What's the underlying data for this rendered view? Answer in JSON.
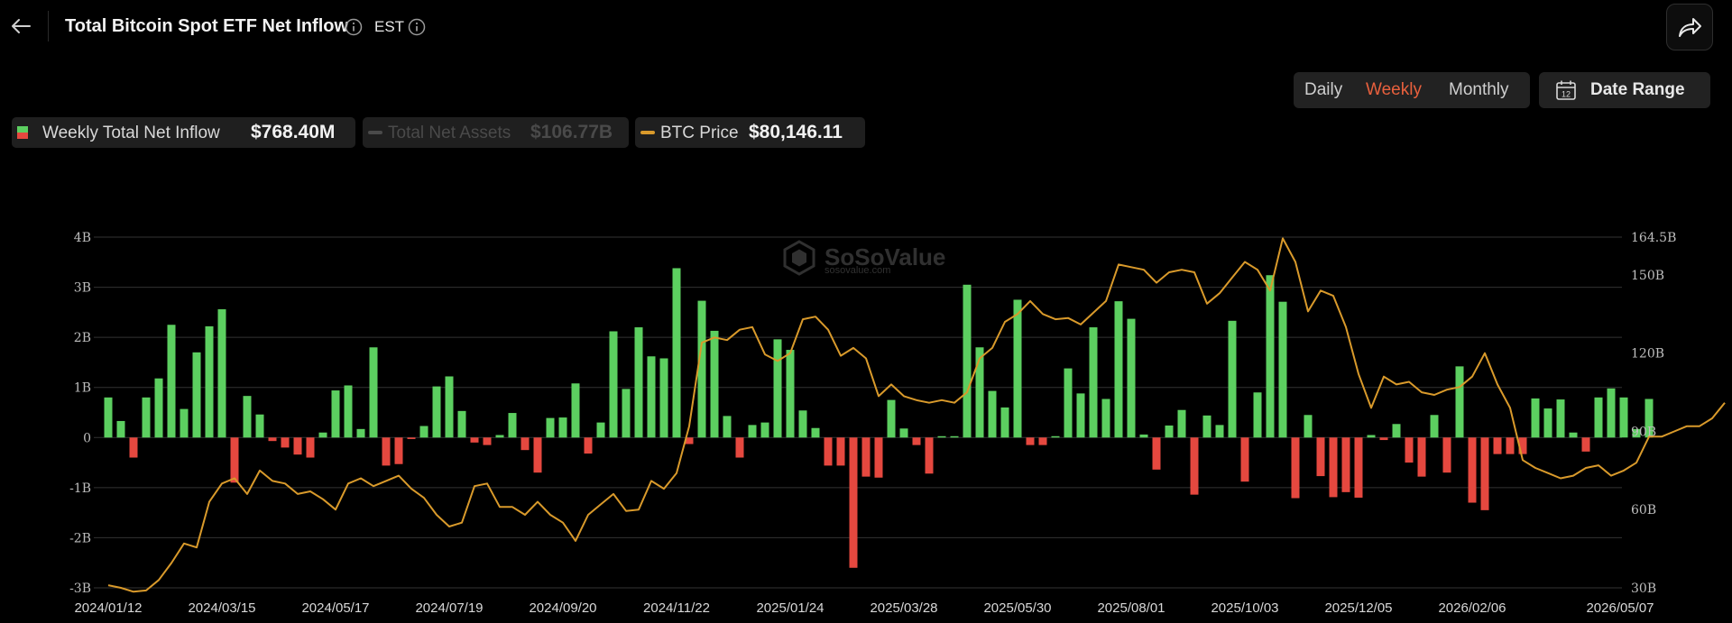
{
  "header": {
    "title": "Total Bitcoin Spot ETF Net Inflow",
    "timezone": "EST"
  },
  "controls": {
    "tabs": [
      {
        "label": "Daily",
        "active": false
      },
      {
        "label": "Weekly",
        "active": true
      },
      {
        "label": "Monthly",
        "active": false
      }
    ],
    "date_range_label": "Date Range",
    "date_range_icon_text": "12"
  },
  "legend": [
    {
      "name": "Weekly Total Net Inflow",
      "value": "$768.40M",
      "enabled": true
    },
    {
      "name": "Total Net Assets",
      "value": "$106.77B",
      "enabled": false
    },
    {
      "name": "BTC Price",
      "value": "$80,146.11",
      "enabled": true
    }
  ],
  "watermark": {
    "text": "SoSoValue",
    "sub": "sosovalue.com"
  },
  "colors": {
    "positive": "#5ccf60",
    "negative": "#e5483f",
    "price_line": "#d99a2b",
    "accent": "#e8603d"
  },
  "chart_data": {
    "type": "bar+line",
    "left_axis": {
      "ticks": [
        "4B",
        "3B",
        "2B",
        "1B",
        "0",
        "-1B",
        "-2B",
        "-3B"
      ],
      "range": [
        -3,
        4
      ],
      "unit": "B USD"
    },
    "right_axis": {
      "ticks": [
        "164.5B",
        "150B",
        "120B",
        "90B",
        "60B",
        "30B"
      ],
      "range": [
        30,
        164.5
      ]
    },
    "x_tick_labels": [
      "2024/01/12",
      "2024/03/15",
      "2024/05/17",
      "2024/07/19",
      "2024/09/20",
      "2024/11/22",
      "2025/01/24",
      "2025/03/28",
      "2025/05/30",
      "2025/08/01",
      "2025/10/03",
      "2025/12/05",
      "2026/02/06",
      "2026/05/07"
    ],
    "first_week": "2024/01/12",
    "interval": "weekly",
    "series": [
      {
        "name": "Weekly Total Net Inflow",
        "type": "bar",
        "values": [
          0.8,
          0.33,
          -0.4,
          0.8,
          1.18,
          2.25,
          0.57,
          1.7,
          2.22,
          2.56,
          -0.9,
          0.83,
          0.46,
          -0.07,
          -0.2,
          -0.34,
          -0.4,
          0.1,
          0.94,
          1.04,
          0.17,
          1.8,
          -0.56,
          -0.53,
          -0.03,
          0.23,
          1.02,
          1.22,
          0.53,
          -0.1,
          -0.15,
          0.05,
          0.49,
          -0.25,
          -0.7,
          0.39,
          0.4,
          1.08,
          -0.32,
          0.3,
          2.12,
          0.97,
          2.2,
          1.62,
          1.58,
          3.38,
          -0.13,
          2.73,
          2.13,
          0.43,
          -0.4,
          0.25,
          0.3,
          1.96,
          1.75,
          0.54,
          0.19,
          -0.56,
          -0.56,
          -2.6,
          -0.78,
          -0.8,
          0.75,
          0.18,
          -0.15,
          -0.72,
          0.02,
          0.02,
          3.05,
          1.8,
          0.93,
          0.6,
          2.75,
          -0.15,
          -0.15,
          0.02,
          1.38,
          0.88,
          2.2,
          0.77,
          2.72,
          2.37,
          0.06,
          -0.64,
          0.24,
          0.55,
          -1.14,
          0.44,
          0.25,
          2.33,
          -0.88,
          0.9,
          3.24,
          2.71,
          -1.21,
          0.45,
          -0.77,
          -1.19,
          -1.09,
          -1.2,
          0.05,
          -0.05,
          0.27,
          -0.5,
          -0.78,
          0.45,
          -0.7,
          1.42,
          -1.3,
          -1.45,
          -0.33,
          -0.33,
          -0.33,
          0.78,
          0.58,
          0.76,
          0.1,
          -0.28,
          0.8,
          0.98,
          0.8,
          0.17,
          0.77
        ]
      },
      {
        "name": "BTC Price",
        "type": "line",
        "values": [
          31,
          30,
          28.5,
          29,
          33,
          39.5,
          47,
          45.5,
          63,
          70,
          72,
          66,
          75,
          71,
          70,
          66,
          67,
          64,
          60,
          70,
          72,
          69,
          71,
          73,
          68,
          64.5,
          58,
          53.5,
          55,
          69,
          70,
          61,
          61,
          58,
          63,
          58,
          55,
          48,
          58,
          62,
          66,
          59.5,
          60,
          71,
          68,
          74,
          92,
          124,
          126,
          125,
          129,
          130,
          119.5,
          117,
          120,
          133,
          134,
          129,
          119,
          122,
          118,
          103.5,
          108,
          103.5,
          102,
          101,
          102,
          101,
          105,
          118,
          122,
          132,
          135,
          140,
          135,
          133,
          133.5,
          131,
          135.5,
          140,
          154,
          153,
          152,
          147,
          151,
          152,
          151,
          139,
          143,
          149,
          155,
          152,
          144,
          164,
          155,
          136,
          144,
          142,
          130,
          112,
          99,
          111,
          108,
          109,
          105,
          104,
          106,
          107,
          111,
          120,
          108,
          99,
          79,
          76,
          74,
          72,
          73,
          76,
          77,
          73,
          75,
          78,
          88,
          88,
          90,
          92,
          92,
          95,
          101
        ]
      }
    ]
  }
}
